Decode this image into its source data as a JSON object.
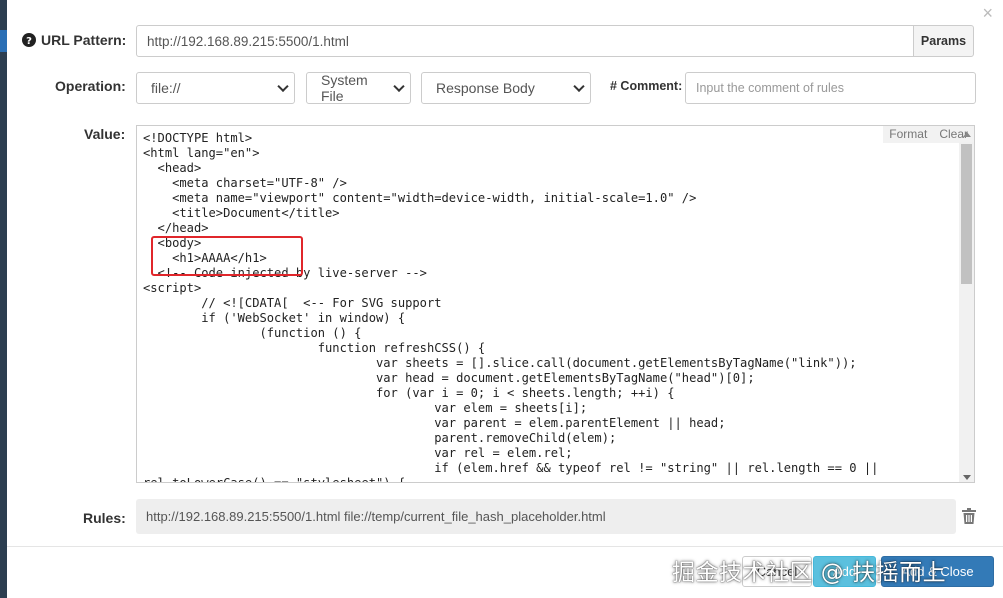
{
  "form": {
    "url_pattern": {
      "label": "URL Pattern:",
      "value": "http://192.168.89.215:5500/1.html",
      "params_button": "Params"
    },
    "operation": {
      "label": "Operation:",
      "protocol": "file://",
      "source": "System File",
      "target": "Response Body"
    },
    "comment": {
      "label": "# Comment:",
      "placeholder": "Input the comment of rules"
    },
    "value": {
      "label": "Value:",
      "format_button": "Format",
      "clear_button": "Clear",
      "code_lines": [
        "<!DOCTYPE html>",
        "<html lang=\"en\">",
        "  <head>",
        "    <meta charset=\"UTF-8\" />",
        "    <meta name=\"viewport\" content=\"width=device-width, initial-scale=1.0\" />",
        "    <title>Document</title>",
        "  </head>",
        "  <body>",
        "    <h1>AAAA</h1>",
        "  <!-- Code injected by live-server -->",
        "<script>",
        "        // <![CDATA[  <-- For SVG support",
        "        if ('WebSocket' in window) {",
        "                (function () {",
        "                        function refreshCSS() {",
        "                                var sheets = [].slice.call(document.getElementsByTagName(\"link\"));",
        "                                var head = document.getElementsByTagName(\"head\")[0];",
        "                                for (var i = 0; i < sheets.length; ++i) {",
        "                                        var elem = sheets[i];",
        "                                        var parent = elem.parentElement || head;",
        "                                        parent.removeChild(elem);",
        "                                        var rel = elem.rel;",
        "                                        if (elem.href && typeof rel != \"string\" || rel.length == 0 ||",
        "rel.toLowerCase() == \"stylesheet\") {"
      ]
    },
    "rules": {
      "label": "Rules:",
      "value": "http://192.168.89.215:5500/1.html file://temp/current_file_hash_placeholder.html"
    }
  },
  "footer": {
    "cancel": "Cancel",
    "add": "Add",
    "add_close": "Add & Close"
  },
  "watermark": "掘金技术社区 @ 扶摇而上",
  "colors": {
    "highlight_box": "#e0262b",
    "primary": "#337ab7",
    "info": "#5bc0de"
  }
}
